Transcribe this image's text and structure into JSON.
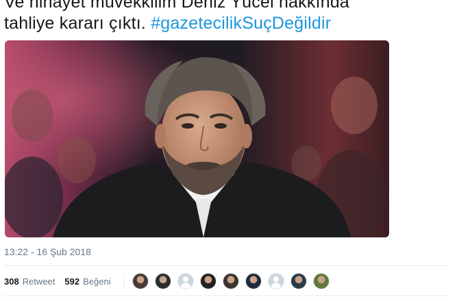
{
  "tweet": {
    "text_line1": "Ve nihayet müvekkilim Deniz Yücel hakkında",
    "text_line2": "tahliye kararı çıktı. ",
    "hashtag": "#gazetecilikSuçDeğildir",
    "timestamp": "13:22 - 16 Şub 2018"
  },
  "stats": {
    "retweet_count": "308",
    "retweet_label": "Retweet",
    "like_count": "592",
    "like_label": "Beğeni"
  },
  "likers": [
    {
      "icon": "user-avatar-photo",
      "color": "#4a3a34"
    },
    {
      "icon": "user-avatar-photo",
      "color": "#2c2c2c"
    },
    {
      "icon": "default-avatar-icon",
      "color": "#ccd6dd"
    },
    {
      "icon": "user-avatar-photo",
      "color": "#222222"
    },
    {
      "icon": "user-avatar-photo",
      "color": "#3b3430"
    },
    {
      "icon": "user-avatar-photo",
      "color": "#1f2a3a"
    },
    {
      "icon": "default-avatar-icon",
      "color": "#ccd6dd"
    },
    {
      "icon": "user-avatar-photo",
      "color": "#2d3b46"
    },
    {
      "icon": "user-avatar-photo",
      "color": "#5f7a3a"
    }
  ],
  "colors": {
    "hashtag": "#1b95e0",
    "meta_text": "#657786",
    "divider": "#e6ecf0"
  }
}
